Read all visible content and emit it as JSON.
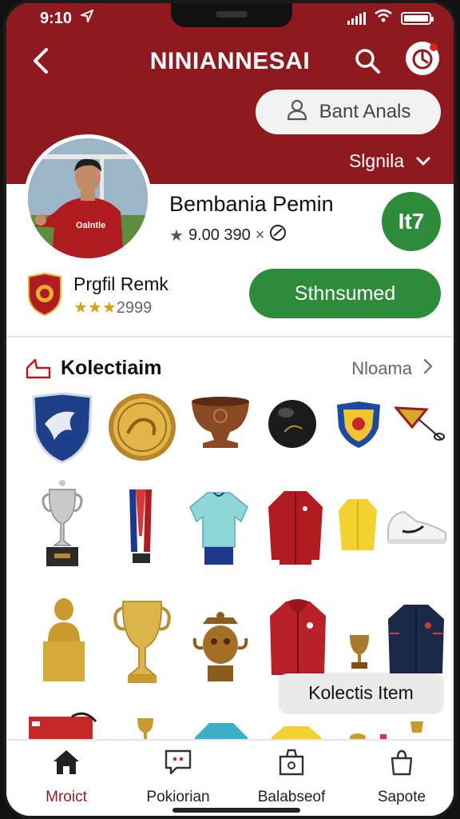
{
  "status": {
    "time": "9:10"
  },
  "header": {
    "title": "NINIANNESAI",
    "search_pill_label": "Bant Anals",
    "dropdown_label": "Slgnila"
  },
  "player": {
    "name": "Bembania Pemin",
    "rating": "9.00 390",
    "badge": "It7",
    "jersey_text": "Oalntle"
  },
  "profile": {
    "name": "Prgfil Remk",
    "stars": "★★★",
    "score": "2999",
    "cta_label": "Sthnsumed"
  },
  "collection": {
    "title": "Kolectiaim",
    "link_label": "Nloama",
    "toast": "Kolectis Item"
  },
  "tabs": [
    {
      "label": "Mroict"
    },
    {
      "label": "Pokiorian"
    },
    {
      "label": "Balabseof"
    },
    {
      "label": "Sapote"
    }
  ],
  "colors": {
    "brand": "#8e1a1f",
    "accent_green": "#2e8b3a"
  }
}
